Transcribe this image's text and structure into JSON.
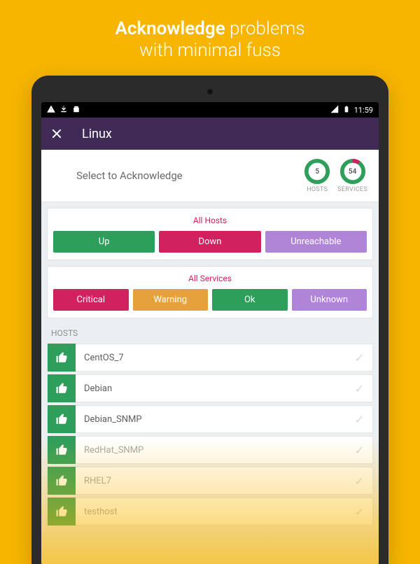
{
  "promo": {
    "bold": "Acknowledge",
    "line1_rest": " problems",
    "line2": "with minimal fuss"
  },
  "statusbar": {
    "time": "11:59"
  },
  "appbar": {
    "title": "Linux"
  },
  "header": {
    "select_label": "Select to Acknowledge",
    "hosts": {
      "count": "5",
      "label": "HOSTS"
    },
    "services": {
      "count": "54",
      "label": "SERVICES"
    }
  },
  "filters": {
    "hosts": {
      "caption": "All Hosts",
      "buttons": [
        "Up",
        "Down",
        "Unreachable"
      ]
    },
    "services": {
      "caption": "All Services",
      "buttons": [
        "Critical",
        "Warning",
        "Ok",
        "Unknown"
      ]
    }
  },
  "list": {
    "section": "HOSTS",
    "items": [
      {
        "name": "CentOS_7"
      },
      {
        "name": "Debian"
      },
      {
        "name": "Debian_SNMP"
      },
      {
        "name": "RedHat_SNMP"
      },
      {
        "name": "RHEL7"
      },
      {
        "name": "testhost"
      }
    ]
  },
  "colors": {
    "green": "#2e9e5b",
    "red": "#d1225f",
    "purple": "#b085d8",
    "orange": "#e7a13c"
  }
}
